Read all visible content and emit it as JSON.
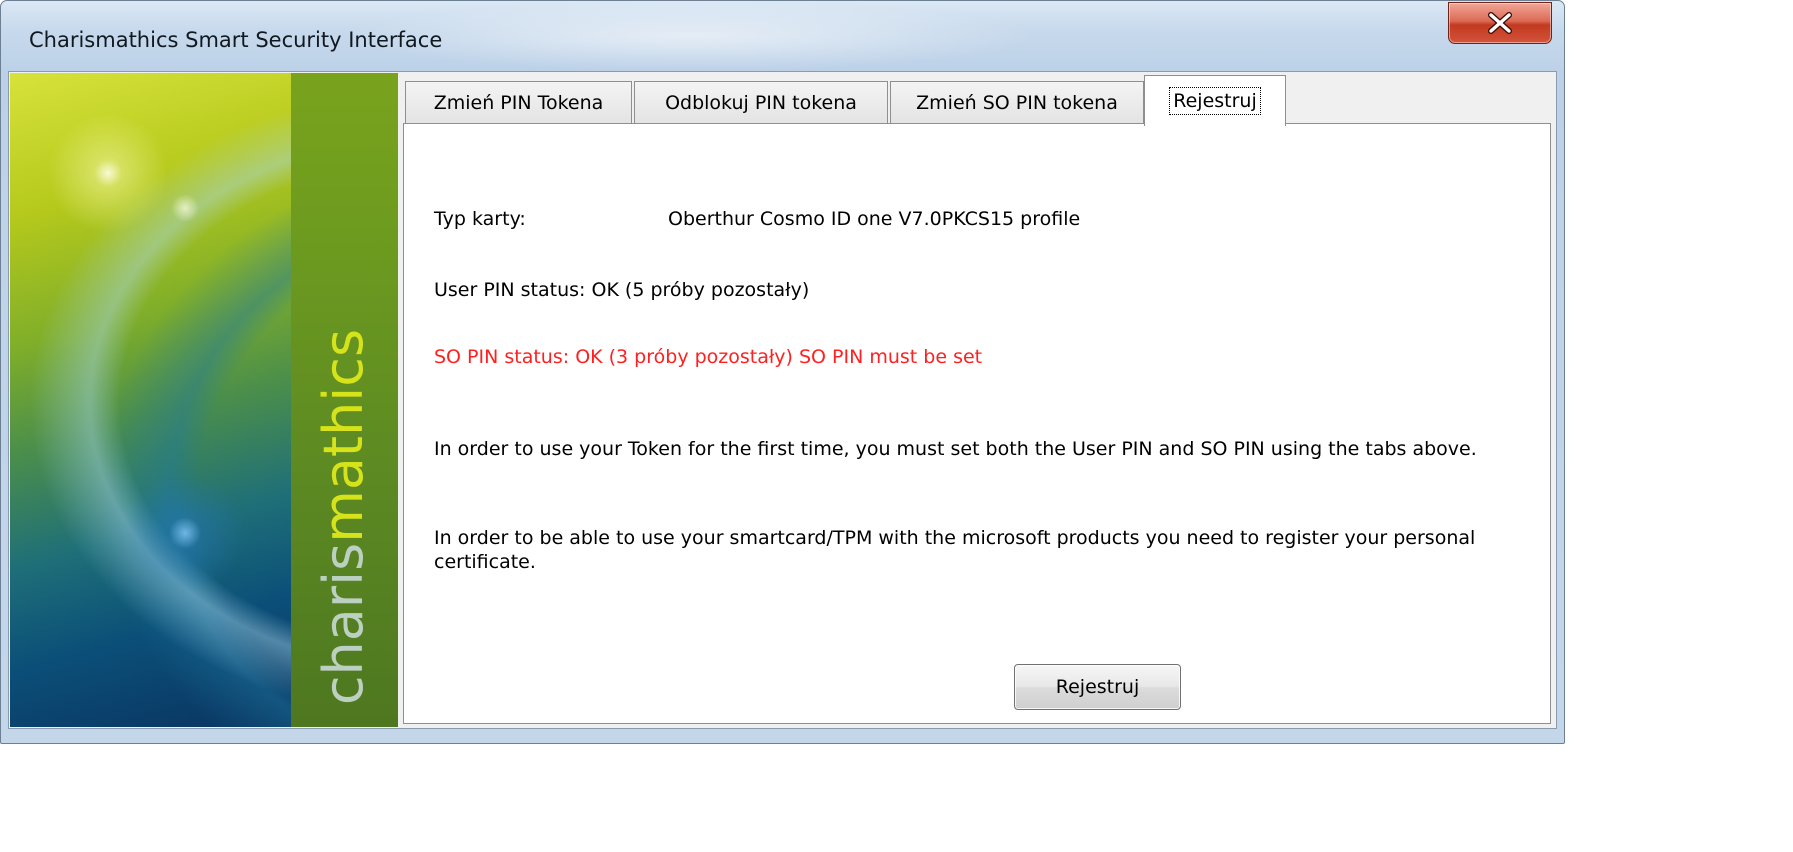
{
  "window": {
    "title": "Charismathics Smart Security Interface",
    "close_icon": "close-icon"
  },
  "branding": {
    "text_part1": "charis",
    "text_part2": "mathics"
  },
  "tabs": [
    {
      "label": "Zmień PIN Tokena",
      "active": false
    },
    {
      "label": "Odblokuj PIN tokena",
      "active": false
    },
    {
      "label": "Zmień SO PIN tokena",
      "active": false
    },
    {
      "label": "Rejestruj",
      "active": true
    }
  ],
  "panel": {
    "card_type_label": "Typ karty:",
    "card_type_value": "Oberthur Cosmo ID one V7.0PKCS15 profile",
    "user_pin_status": "User PIN status: OK (5 próby pozostały)",
    "so_pin_status": "SO PIN status: OK (3 próby pozostały)  SO PIN must be set",
    "info_paragraph_1": "In order to use your Token for the first time, you must set both the User PIN and SO PIN using the tabs above.",
    "info_paragraph_2": "In order to be able to use your smartcard/TPM with the microsoft products you need to register your personal certificate.",
    "register_button": "Rejestruj"
  },
  "colors": {
    "warning_text": "#ff2020",
    "brand_green": "#6d9b1f",
    "brand_accent": "#d6e31a"
  }
}
